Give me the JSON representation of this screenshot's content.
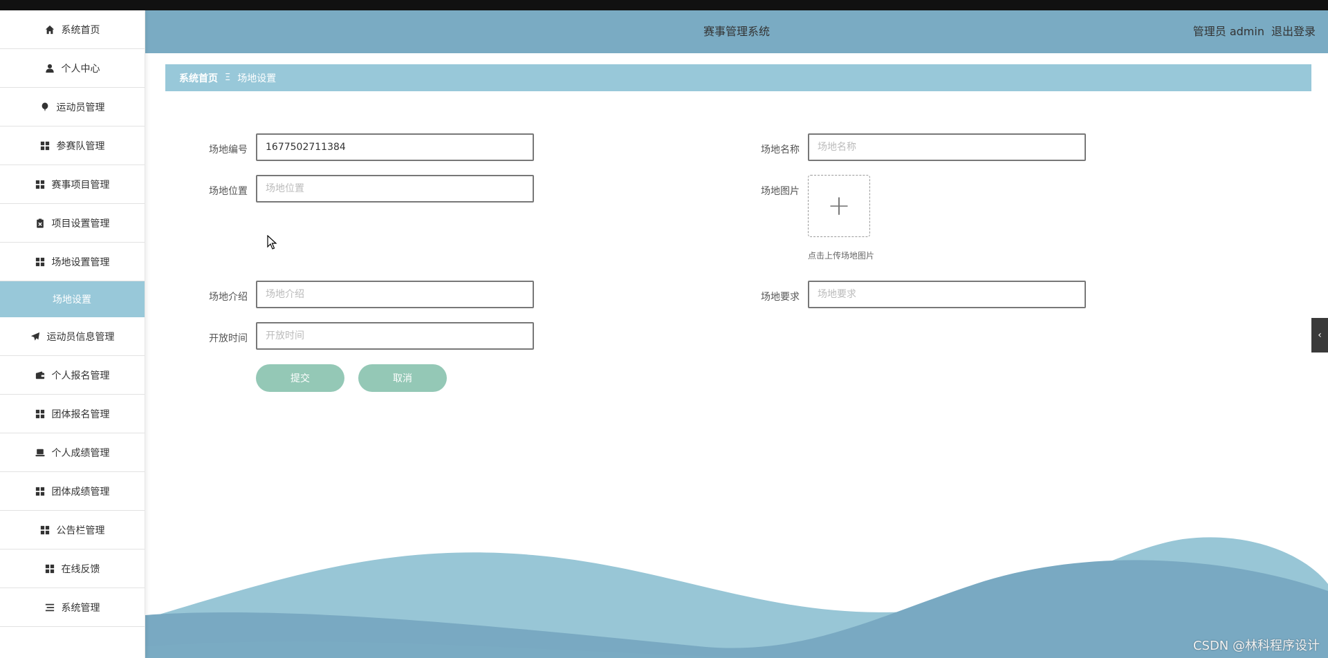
{
  "header": {
    "title": "赛事管理系统",
    "user": "管理员 admin",
    "logout": "退出登录"
  },
  "breadcrumb": {
    "home": "系统首页",
    "separator": "Ξ",
    "current": "场地设置"
  },
  "sidebar": {
    "items": [
      {
        "label": "系统首页",
        "icon": "home-icon"
      },
      {
        "label": "个人中心",
        "icon": "user-icon"
      },
      {
        "label": "运动员管理",
        "icon": "balloon-icon"
      },
      {
        "label": "参赛队管理",
        "icon": "grid-icon"
      },
      {
        "label": "赛事项目管理",
        "icon": "grid-icon"
      },
      {
        "label": "项目设置管理",
        "icon": "clipboard-x-icon"
      },
      {
        "label": "场地设置管理",
        "icon": "grid-icon"
      },
      {
        "label": "场地设置",
        "icon": "",
        "sub": true,
        "active": true
      },
      {
        "label": "运动员信息管理",
        "icon": "paper-plane-icon"
      },
      {
        "label": "个人报名管理",
        "icon": "wallet-icon"
      },
      {
        "label": "团体报名管理",
        "icon": "grid-icon"
      },
      {
        "label": "个人成绩管理",
        "icon": "laptop-icon"
      },
      {
        "label": "团体成绩管理",
        "icon": "grid-icon"
      },
      {
        "label": "公告栏管理",
        "icon": "grid-icon"
      },
      {
        "label": "在线反馈",
        "icon": "grid-icon"
      },
      {
        "label": "系统管理",
        "icon": "list-icon"
      }
    ]
  },
  "form": {
    "venue_no": {
      "label": "场地编号",
      "value": "1677502711384",
      "placeholder": "场地编号"
    },
    "venue_name": {
      "label": "场地名称",
      "value": "",
      "placeholder": "场地名称"
    },
    "venue_location": {
      "label": "场地位置",
      "value": "",
      "placeholder": "场地位置"
    },
    "venue_image": {
      "label": "场地图片",
      "tip": "点击上传场地图片"
    },
    "venue_intro": {
      "label": "场地介绍",
      "value": "",
      "placeholder": "场地介绍"
    },
    "venue_requirement": {
      "label": "场地要求",
      "value": "",
      "placeholder": "场地要求"
    },
    "open_time": {
      "label": "开放时间",
      "value": "",
      "placeholder": "开放时间"
    },
    "submit_label": "提交",
    "cancel_label": "取消"
  },
  "side_tab": {
    "glyph": "‹"
  },
  "watermark": "CSDN @林科程序设计",
  "colors": {
    "header": "#7aabc3",
    "breadcrumb": "#98c8d9",
    "button": "#94c8b6",
    "wave_light": "#98c6d6",
    "wave_dark": "#79a9c2"
  }
}
